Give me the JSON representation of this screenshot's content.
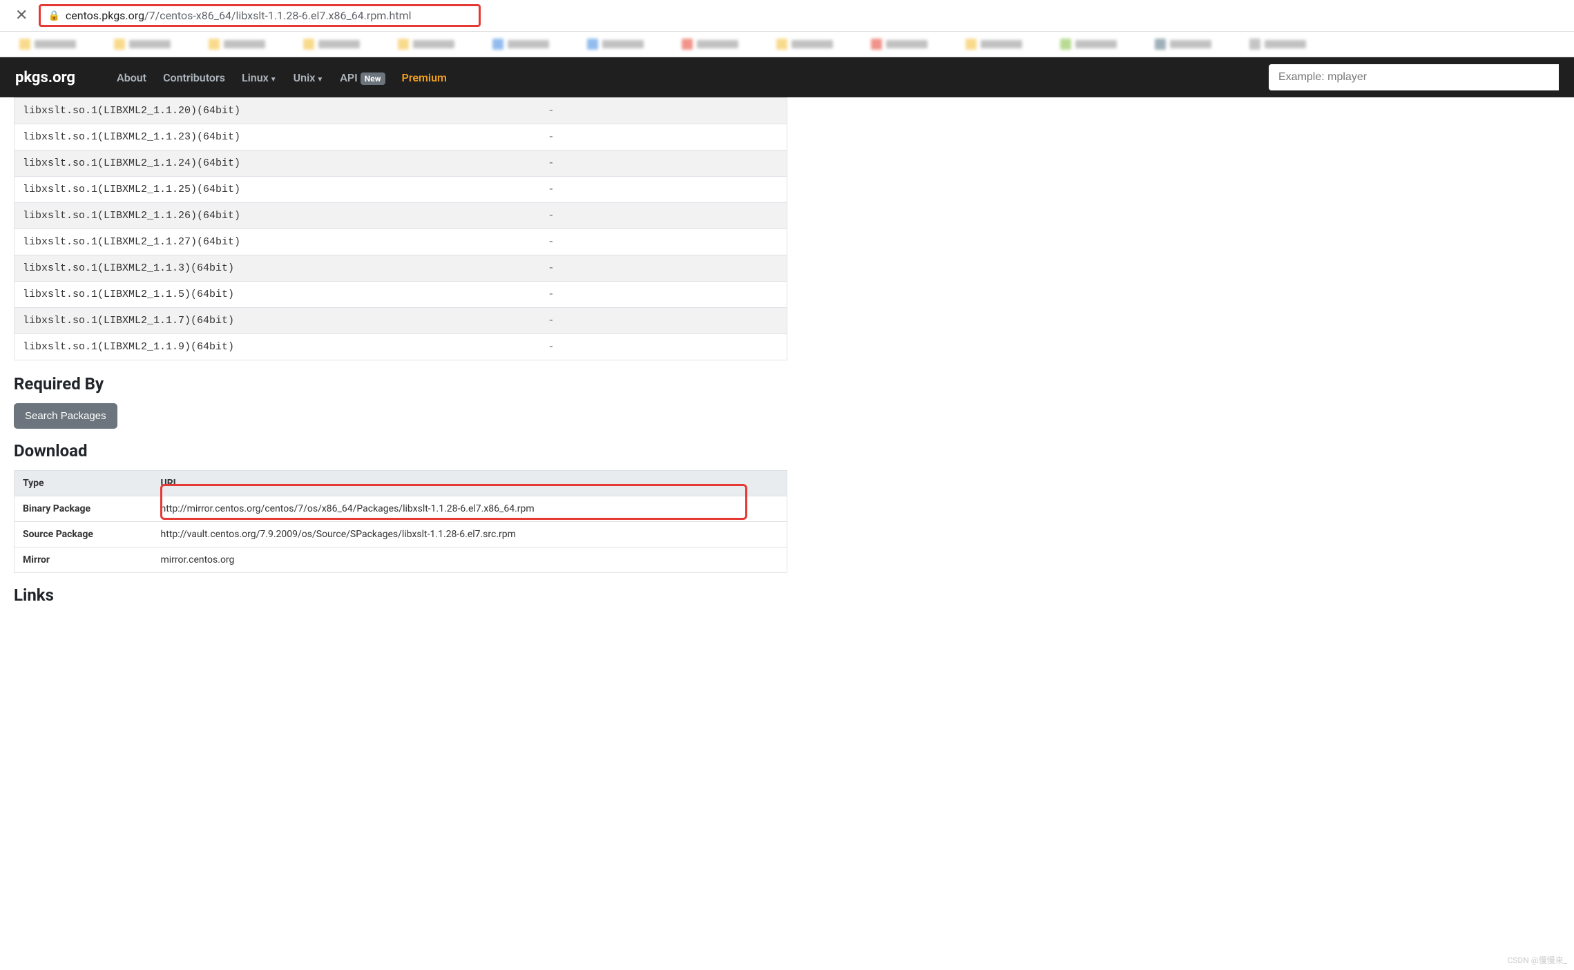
{
  "browser": {
    "url_host": "centos.pkgs.org",
    "url_path": "/7/centos-x86_64/libxslt-1.1.28-6.el7.x86_64.rpm.html"
  },
  "header": {
    "logo": "pkgs.org",
    "nav": {
      "about": "About",
      "contributors": "Contributors",
      "linux": "Linux",
      "unix": "Unix",
      "api": "API",
      "api_badge": "New",
      "premium": "Premium"
    },
    "search_placeholder": "Example: mplayer"
  },
  "provides": [
    {
      "name": "libxslt.so.1(LIBXML2_1.1.20)(64bit)",
      "val": "-"
    },
    {
      "name": "libxslt.so.1(LIBXML2_1.1.23)(64bit)",
      "val": "-"
    },
    {
      "name": "libxslt.so.1(LIBXML2_1.1.24)(64bit)",
      "val": "-"
    },
    {
      "name": "libxslt.so.1(LIBXML2_1.1.25)(64bit)",
      "val": "-"
    },
    {
      "name": "libxslt.so.1(LIBXML2_1.1.26)(64bit)",
      "val": "-"
    },
    {
      "name": "libxslt.so.1(LIBXML2_1.1.27)(64bit)",
      "val": "-"
    },
    {
      "name": "libxslt.so.1(LIBXML2_1.1.3)(64bit)",
      "val": "-"
    },
    {
      "name": "libxslt.so.1(LIBXML2_1.1.5)(64bit)",
      "val": "-"
    },
    {
      "name": "libxslt.so.1(LIBXML2_1.1.7)(64bit)",
      "val": "-"
    },
    {
      "name": "libxslt.so.1(LIBXML2_1.1.9)(64bit)",
      "val": "-"
    }
  ],
  "sections": {
    "required_by": "Required By",
    "search_packages": "Search Packages",
    "download": "Download",
    "links": "Links"
  },
  "download": {
    "th_type": "Type",
    "th_url": "URL",
    "rows": [
      {
        "type": "Binary Package",
        "url": "http://mirror.centos.org/centos/7/os/x86_64/Packages/libxslt-1.1.28-6.el7.x86_64.rpm"
      },
      {
        "type": "Source Package",
        "url": "http://vault.centos.org/7.9.2009/os/Source/SPackages/libxslt-1.1.28-6.el7.src.rpm"
      },
      {
        "type": "Mirror",
        "url": "mirror.centos.org"
      }
    ]
  },
  "bookmark_colors": [
    "#f5c242",
    "#f5c242",
    "#f5c242",
    "#f5c242",
    "#f5c242",
    "#4a90e2",
    "#4a90e2",
    "#e74c3c",
    "#f5c242",
    "#e74c3c",
    "#f5c242",
    "#8bc34a",
    "#607d8b",
    "#9e9e9e"
  ],
  "watermark": "CSDN @慢慢来_"
}
